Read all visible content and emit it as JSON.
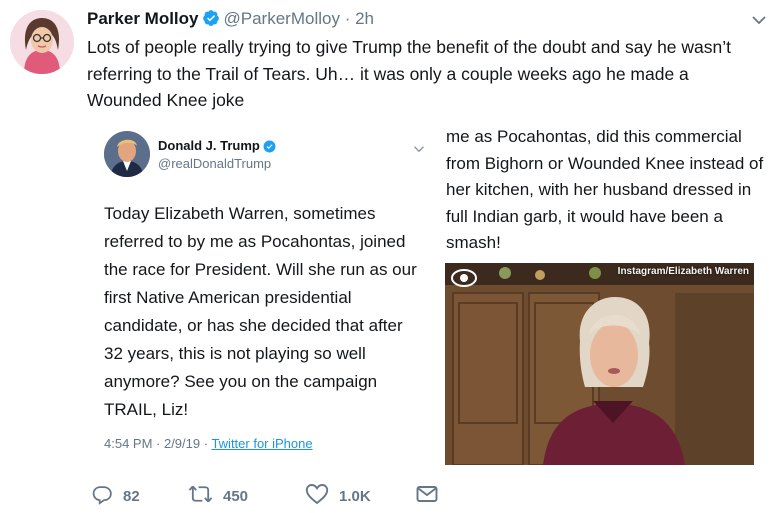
{
  "author": {
    "name": "Parker Molloy",
    "handle": "@ParkerMolloy",
    "separator": "·",
    "time": "2h"
  },
  "tweet": {
    "text": "Lots of people really trying to give Trump the benefit of the doubt and say he wasn’t referring to the Trail of Tears. Uh… it was only a couple weeks ago he made a Wounded Knee joke"
  },
  "embedded": {
    "name": "Donald J. Trump",
    "handle": "@realDonaldTrump",
    "text": "Today Elizabeth Warren, sometimes referred to by me as Pocahontas, joined the race for President. Will she run as our first Native American presidential candidate, or has she decided that after 32 years, this is not playing so well anymore? See you on the campaign TRAIL, Liz!",
    "timestamp": "4:54 PM · 2/9/19 · ",
    "source": "Twitter for iPhone",
    "continuation": "me as Pocahontas, did this commercial from Bighorn or Wounded Knee instead of her kitchen, with her husband dressed in full Indian garb, it would have been a smash!",
    "video_credit": "Instagram/Elizabeth Warren"
  },
  "actions": {
    "replies": "82",
    "retweets": "450",
    "likes": "1.0K"
  },
  "colors": {
    "verified": "#1da1f2",
    "secondary_text": "#657786",
    "link": "#1b95e0"
  }
}
